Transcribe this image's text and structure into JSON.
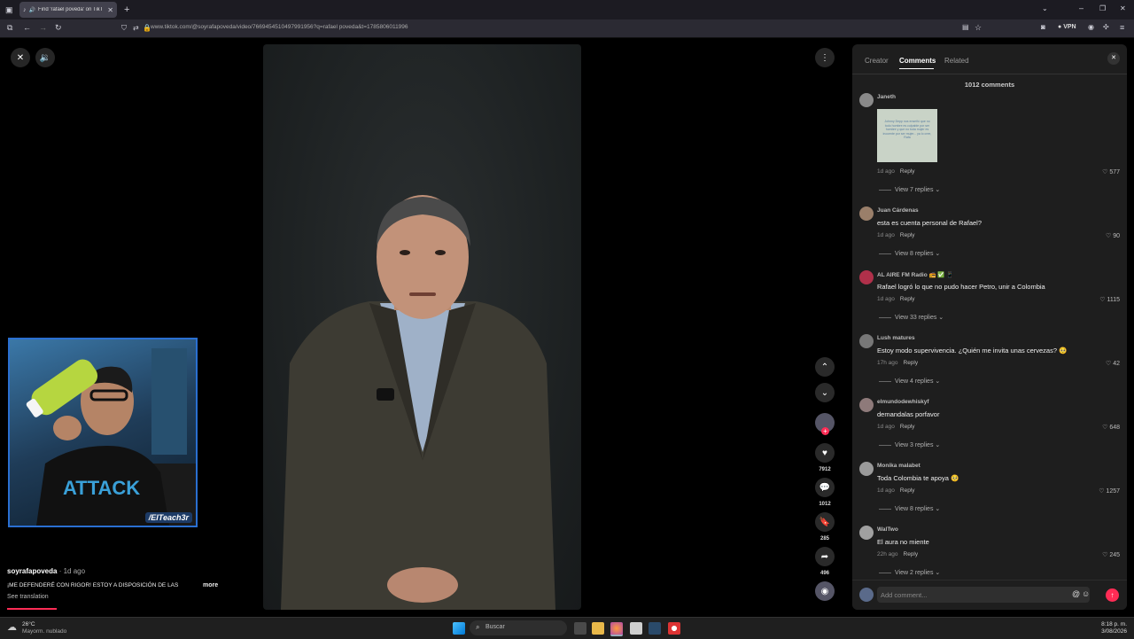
{
  "browser": {
    "tab_title": "Find 'rafael poveda' on TikT",
    "url": "www.tiktok.com/@soyrafapoveda/video/7669454510497991956?q=rafael poveda&t=1785806011996",
    "vpn_label": "VPN"
  },
  "video": {
    "side_actions": {
      "likes": "7912",
      "comments": "1012",
      "saves": "285",
      "shares": "496"
    },
    "caption": {
      "username": "soyrafapoveda",
      "time": " · 1d ago",
      "text": "¡ME DEFENDERÉ CON RIGOR! ESTOY A DISPOSICIÓN DE LAS",
      "more": "more",
      "see_translation": "See translation"
    },
    "webcam_tag": "/ElTeach3r"
  },
  "panel": {
    "tabs": [
      "Creator",
      "Comments",
      "Related"
    ],
    "active_tab": "Comments",
    "count": "1012 comments",
    "sticker_text": "Johnny Depp nos enseñó que no todo hombre es culpable por ser hombre y que no toda mujer es inocente por ser mujer... ya lo cree, Rafa",
    "comments": [
      {
        "user": "Janeth",
        "text": "",
        "time": "1d ago",
        "reply": "Reply",
        "likes": "577",
        "view_replies": "View 7 replies"
      },
      {
        "user": "Juan Cárdenas",
        "text": "esta es cuenta personal de Rafael?",
        "time": "1d ago",
        "reply": "Reply",
        "likes": "90",
        "view_replies": "View 8 replies"
      },
      {
        "user": "AL AIRE FM Radio 📻 ✅ 📱",
        "text": "Rafael logró lo que no pudo hacer Petro, unir a Colombia",
        "time": "1d ago",
        "reply": "Reply",
        "likes": "1115",
        "view_replies": "View 33 replies"
      },
      {
        "user": "Lush matures",
        "text": "Estoy modo supervivencia. ¿Quién me invita unas cervezas? 🥺",
        "time": "17h ago",
        "reply": "Reply",
        "likes": "42",
        "view_replies": "View 4 replies"
      },
      {
        "user": "elmundodewhiskyf",
        "text": "demandalas porfavor",
        "time": "1d ago",
        "reply": "Reply",
        "likes": "648",
        "view_replies": "View 3 replies"
      },
      {
        "user": "Monika malabet",
        "text": "Toda Colombia te apoya 🥺",
        "time": "1d ago",
        "reply": "Reply",
        "likes": "1257",
        "view_replies": "View 8 replies"
      },
      {
        "user": "WalTwo",
        "text": "El aura no miente",
        "time": "22h ago",
        "reply": "Reply",
        "likes": "245",
        "view_replies": "View 2 replies"
      }
    ],
    "add_comment_placeholder": "Add comment..."
  },
  "taskbar": {
    "weather_temp": "26°C",
    "weather_desc": "Mayorm. nublado",
    "search_placeholder": "Buscar",
    "time": "8:18 p. m.",
    "date": "3/08/2026"
  },
  "colors": {
    "tiktok_red": "#fe2c55",
    "cam_border": "#2a6fd1",
    "panel_bg": "#1e1e1e"
  }
}
